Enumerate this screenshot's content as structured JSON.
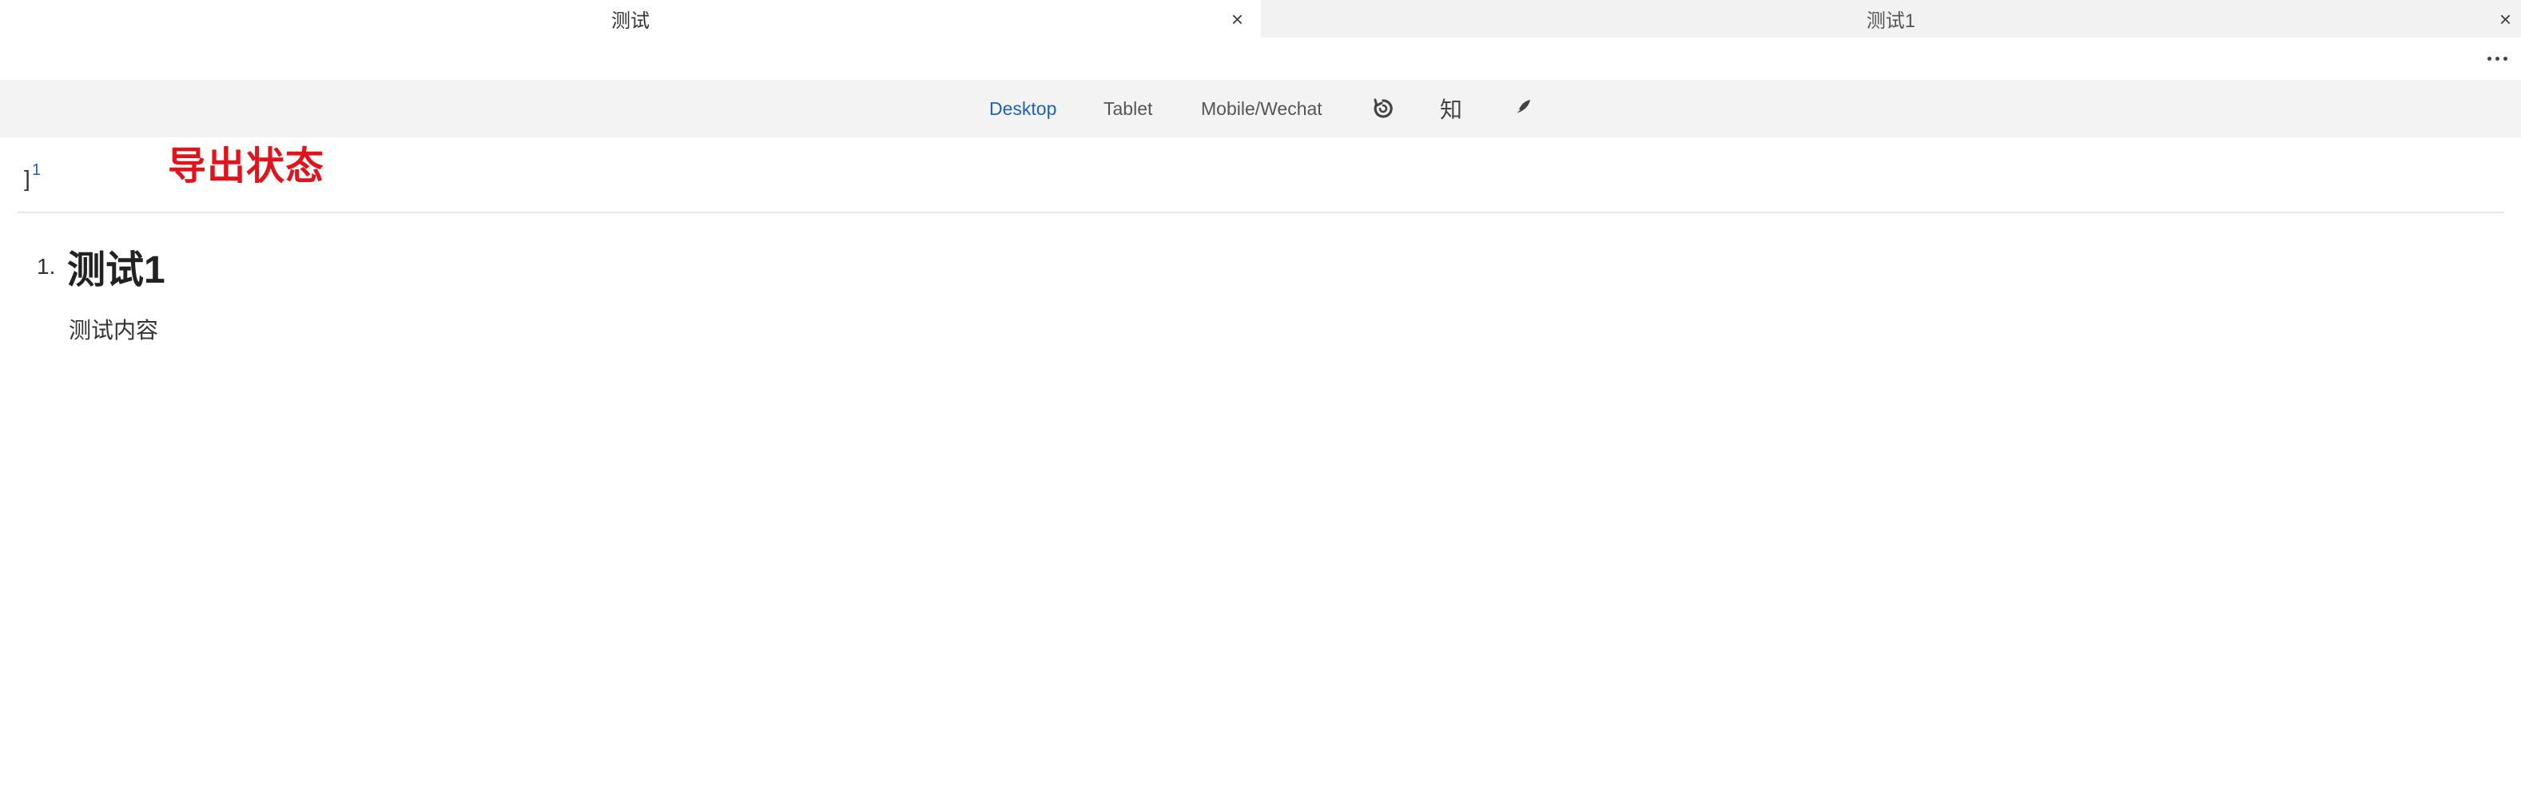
{
  "tabs": [
    {
      "label": "测试",
      "active": true,
      "close": "×"
    },
    {
      "label": "测试1",
      "active": false,
      "close": "×"
    }
  ],
  "toolbar": {
    "desktop_label": "Desktop",
    "tablet_label": "Tablet",
    "mobile_label": "Mobile/Wechat",
    "selected": "Desktop",
    "zhi_label": "知",
    "accent_color": "#1d63b8",
    "icons": [
      "refresh-icon",
      "zhihu-icon",
      "feather-icon"
    ]
  },
  "document": {
    "bracket": "]",
    "footnote_ref": "1",
    "annotation": "导出状态",
    "annotation_color": "#e1141c",
    "list_number": "1.",
    "heading": "测试1",
    "body": "测试内容"
  }
}
